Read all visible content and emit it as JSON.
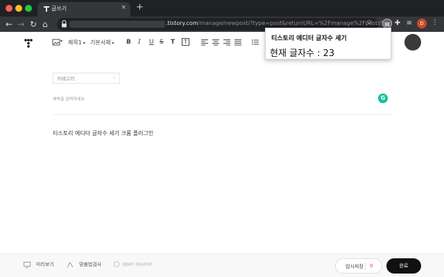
{
  "browser": {
    "tab_title": "글쓰기",
    "tab_close": "×",
    "new_tab": "+",
    "url_host": ".tistory.com",
    "url_path": "/manage/newpost/?type=post&returnURL=%2Fmanage%2Fposts%2F",
    "profile_initial": "D",
    "icons": {
      "back": "arrow-left-icon",
      "forward": "arrow-right-icon",
      "reload": "reload-icon",
      "home": "home-icon",
      "lock": "lock-icon",
      "star": "star-icon",
      "extensions": "puzzle-icon",
      "queue": "reading-list-icon",
      "menu": "kebab-menu-icon"
    },
    "colors": {
      "tab_strip": "#202124",
      "toolbar": "#35363a",
      "profile": "#c94a2c"
    }
  },
  "popup": {
    "title": "티스토리 에디터 글자수 세기",
    "count_text": "현재 글자수 : 23"
  },
  "editor": {
    "toolbar": {
      "heading_label": "제목1",
      "font_label": "기본서체",
      "bold": "B",
      "italic": "I",
      "underline": "U",
      "strike": "S",
      "text_color": "T",
      "text_bg": "T"
    },
    "category_label": "카테고리",
    "title_placeholder": "제목을 입력하세요",
    "grammarly_letter": "G",
    "content_text": "티스토리 에디터 글자수 세기 크롬 플러그인"
  },
  "footer": {
    "preview_label": "미리보기",
    "spellcheck_label": "맞춤법검사",
    "opensource_label": "open source",
    "save_draft_label": "임시저장",
    "draft_count": "0",
    "publish_label": "완료",
    "colors": {
      "draft_count": "#e03c3c",
      "publish_bg": "#111111"
    }
  }
}
